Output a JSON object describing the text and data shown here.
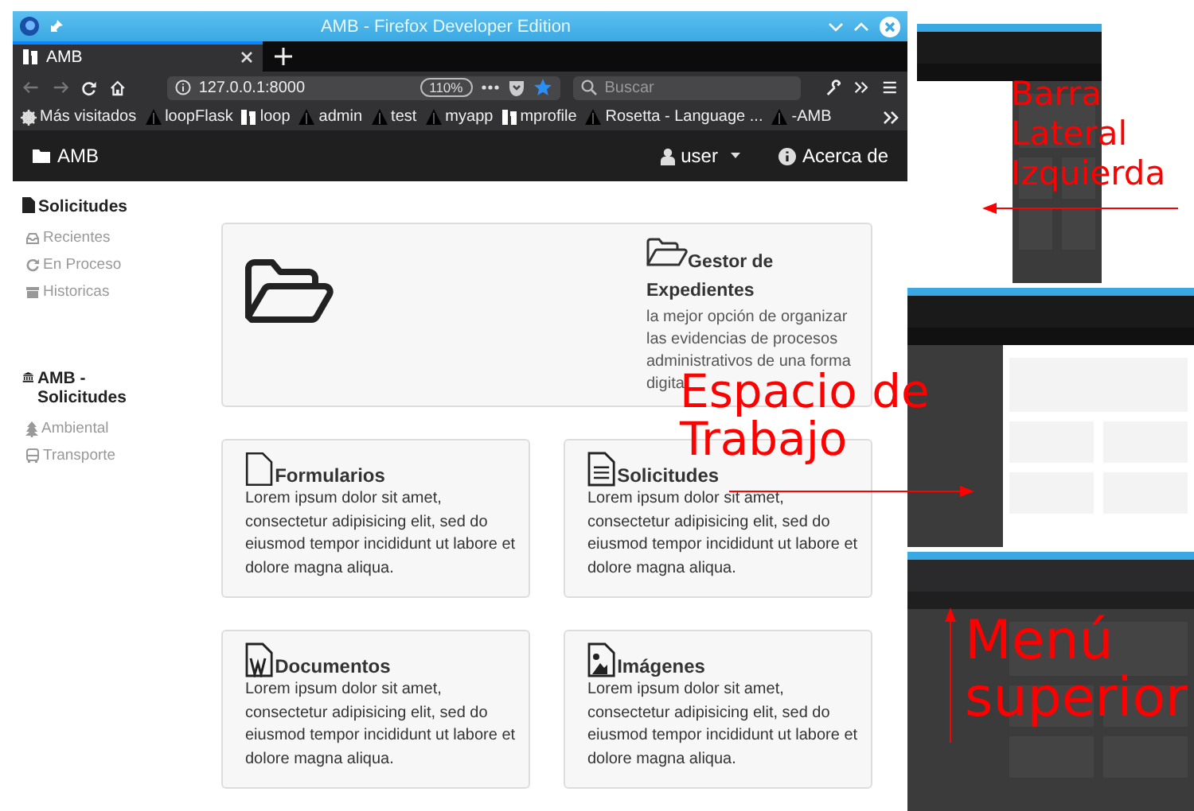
{
  "window": {
    "title": "AMB - Firefox Developer Edition"
  },
  "browser": {
    "tabs": [
      {
        "label": "AMB",
        "selected": true
      }
    ],
    "address": "127.0.0.1:8000",
    "zoom": "110%",
    "search": {
      "placeholder": "Buscar"
    },
    "bookmarks": [
      {
        "label": "Más visitados",
        "kind": "gear"
      },
      {
        "label": "loopFlask",
        "kind": "dark"
      },
      {
        "label": "loop",
        "kind": "light"
      },
      {
        "label": "admin",
        "kind": "dark"
      },
      {
        "label": "test",
        "kind": "dark"
      },
      {
        "label": "myapp",
        "kind": "dark"
      },
      {
        "label": "mprofile",
        "kind": "light"
      },
      {
        "label": "Rosetta - Language ...",
        "kind": "dark"
      },
      {
        "label": "-AMB",
        "kind": "dark"
      }
    ]
  },
  "app": {
    "brand": "AMB",
    "user": "user",
    "about": "Acerca de"
  },
  "sidebar": {
    "sections": [
      {
        "title": "Solicitudes",
        "kind": "file",
        "items": [
          {
            "label": "Recientes",
            "kind": "tray"
          },
          {
            "label": "En Proceso",
            "kind": "refresh"
          },
          {
            "label": "Historicas",
            "kind": "archive"
          }
        ]
      },
      {
        "title": "AMB - Solicitudes",
        "kind": "bank",
        "items": [
          {
            "label": "Ambiental",
            "kind": "tree"
          },
          {
            "label": "Transporte",
            "kind": "bus"
          }
        ]
      }
    ]
  },
  "hero": {
    "title": "Gestor de Expedientes",
    "description_lines": [
      "la mejor opción de organizar",
      "las evidencias de procesos",
      "administrativos de una forma",
      "digita"
    ]
  },
  "cards": [
    {
      "title": "Formularios",
      "kind": "file",
      "text": "Lorem ipsum dolor sit amet, consectetur adipisicing elit, sed do eiusmod tempor incididunt ut labore et dolore magna aliqua."
    },
    {
      "title": "Solicitudes",
      "kind": "filetext",
      "text": "Lorem ipsum dolor sit amet, consectetur adipisicing elit, sed do eiusmod tempor incididunt ut labore et dolore magna aliqua."
    },
    {
      "title": "Documentos",
      "kind": "word",
      "text": "Lorem ipsum dolor sit amet, consectetur adipisicing elit, sed do eiusmod tempor incididunt ut labore et dolore magna aliqua."
    },
    {
      "title": "Imágenes",
      "kind": "image",
      "text": "Lorem ipsum dolor sit amet, consectetur adipisicing elit, sed do eiusmod tempor incididunt ut labore et dolore magna aliqua."
    }
  ],
  "thumbnails": [
    {
      "kind": "sidebar"
    },
    {
      "kind": "workspace"
    },
    {
      "kind": "menu"
    }
  ],
  "annotations": [
    {
      "kind": "workspace",
      "text": "Espacio de Trabajo"
    },
    {
      "kind": "sidebar",
      "text": "Barra Lateral Izquierda"
    },
    {
      "kind": "menu",
      "text": "Menú superior"
    }
  ]
}
